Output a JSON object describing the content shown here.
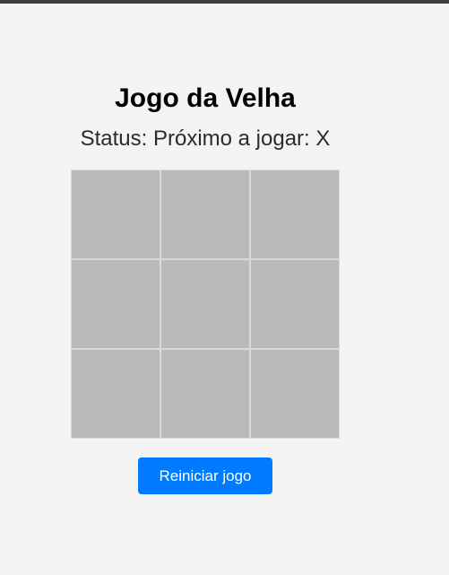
{
  "app": {
    "title": "Jogo da Velha",
    "status_text": "Status: Próximo a jogar: X",
    "reset_label": "Reiniciar jogo"
  },
  "board": {
    "cells": [
      "",
      "",
      "",
      "",
      "",
      "",
      "",
      "",
      ""
    ]
  },
  "colors": {
    "background": "#f4f4f4",
    "cell": "#bababa",
    "cell_border": "#dadada",
    "button": "#007bff",
    "button_text": "#ffffff",
    "top_bar": "#3c3c3c"
  }
}
